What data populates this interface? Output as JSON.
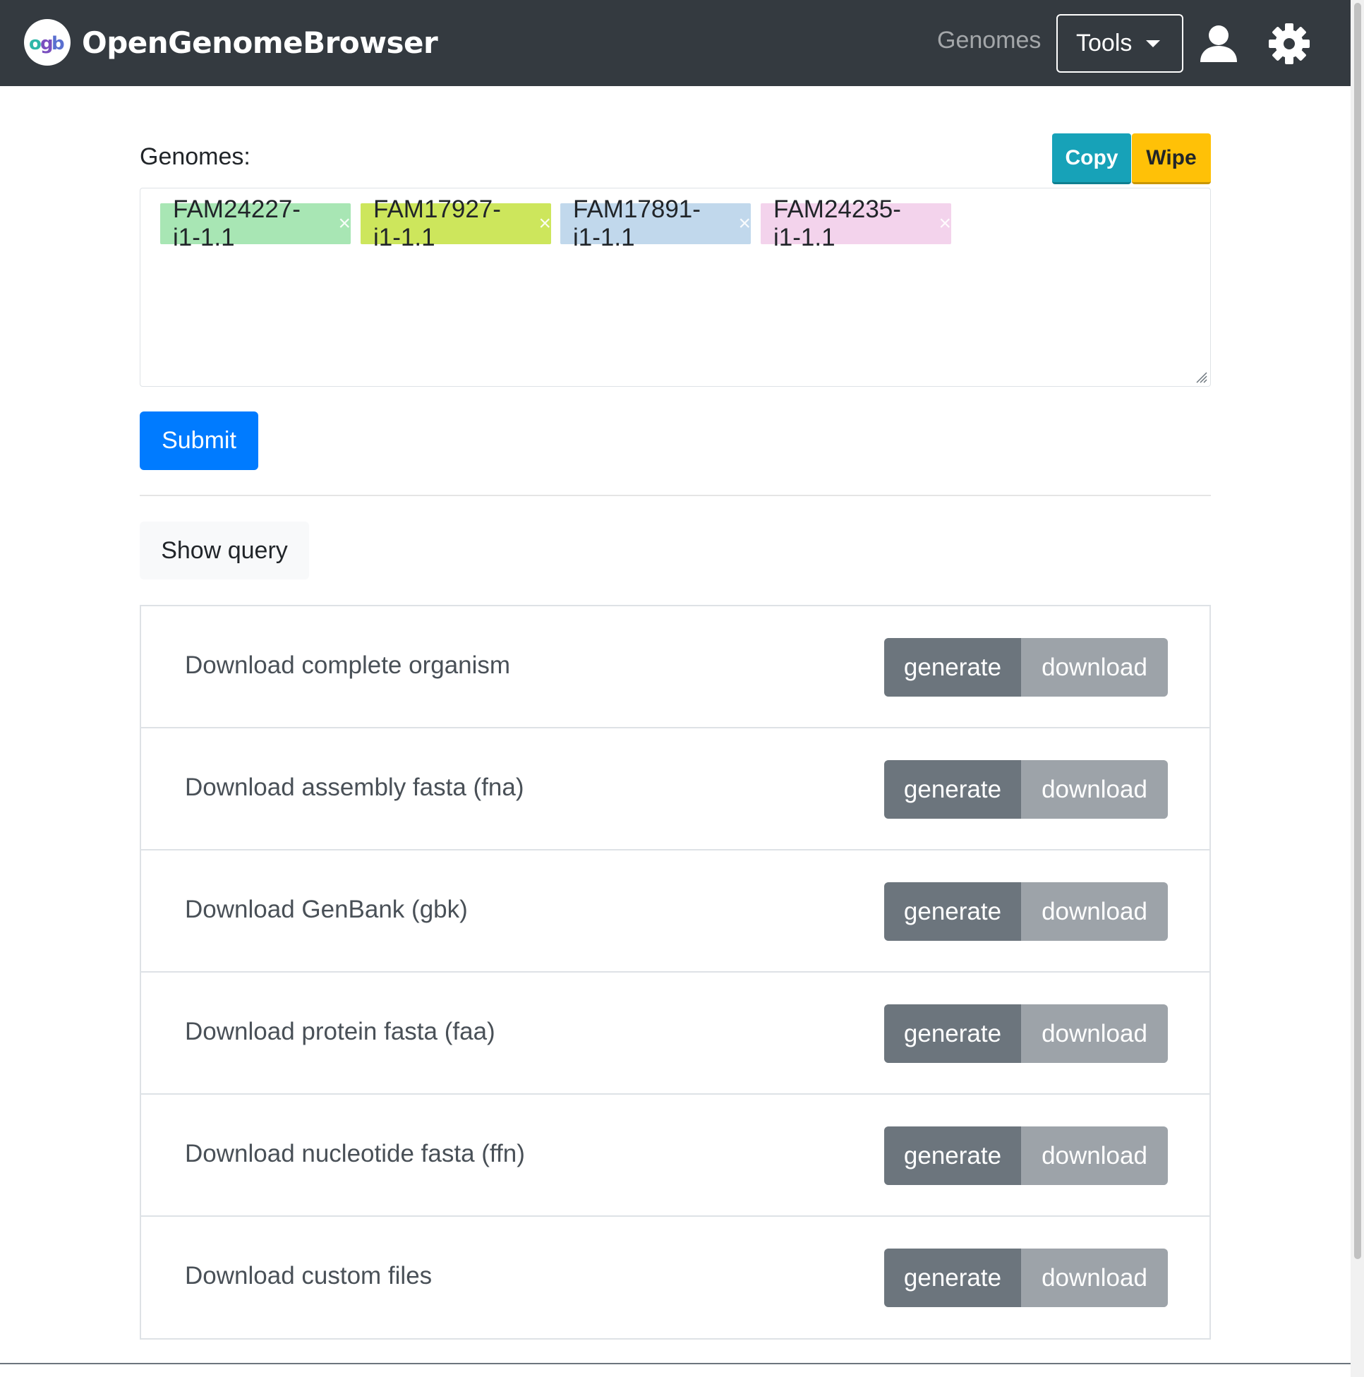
{
  "navbar": {
    "brand_name": "OpenGenomeBrowser",
    "genomes_link": "Genomes",
    "tools_label": "Tools"
  },
  "genome_selector": {
    "label": "Genomes:",
    "copy_label": "Copy",
    "wipe_label": "Wipe",
    "tags": [
      {
        "name": "FAM24227-i1-1.1",
        "color": "#a8e6b4"
      },
      {
        "name": "FAM17927-i1-1.1",
        "color": "#cde65c"
      },
      {
        "name": "FAM17891-i1-1.1",
        "color": "#c1d8ec"
      },
      {
        "name": "FAM24235-i1-1.1",
        "color": "#f3d3ec"
      }
    ],
    "remove_symbol": "×"
  },
  "submit_label": "Submit",
  "show_query_label": "Show query",
  "downloads": [
    {
      "label": "Download complete organism",
      "generate": "generate",
      "download": "download"
    },
    {
      "label": "Download assembly fasta (fna)",
      "generate": "generate",
      "download": "download"
    },
    {
      "label": "Download GenBank (gbk)",
      "generate": "generate",
      "download": "download"
    },
    {
      "label": "Download protein fasta (faa)",
      "generate": "generate",
      "download": "download"
    },
    {
      "label": "Download nucleotide fasta (ffn)",
      "generate": "generate",
      "download": "download"
    },
    {
      "label": "Download custom files",
      "generate": "generate",
      "download": "download"
    }
  ],
  "colors": {
    "navbar_bg": "#343a40",
    "primary": "#007bff",
    "info": "#17a2b8",
    "warning": "#ffc107",
    "secondary": "#6c757d"
  }
}
